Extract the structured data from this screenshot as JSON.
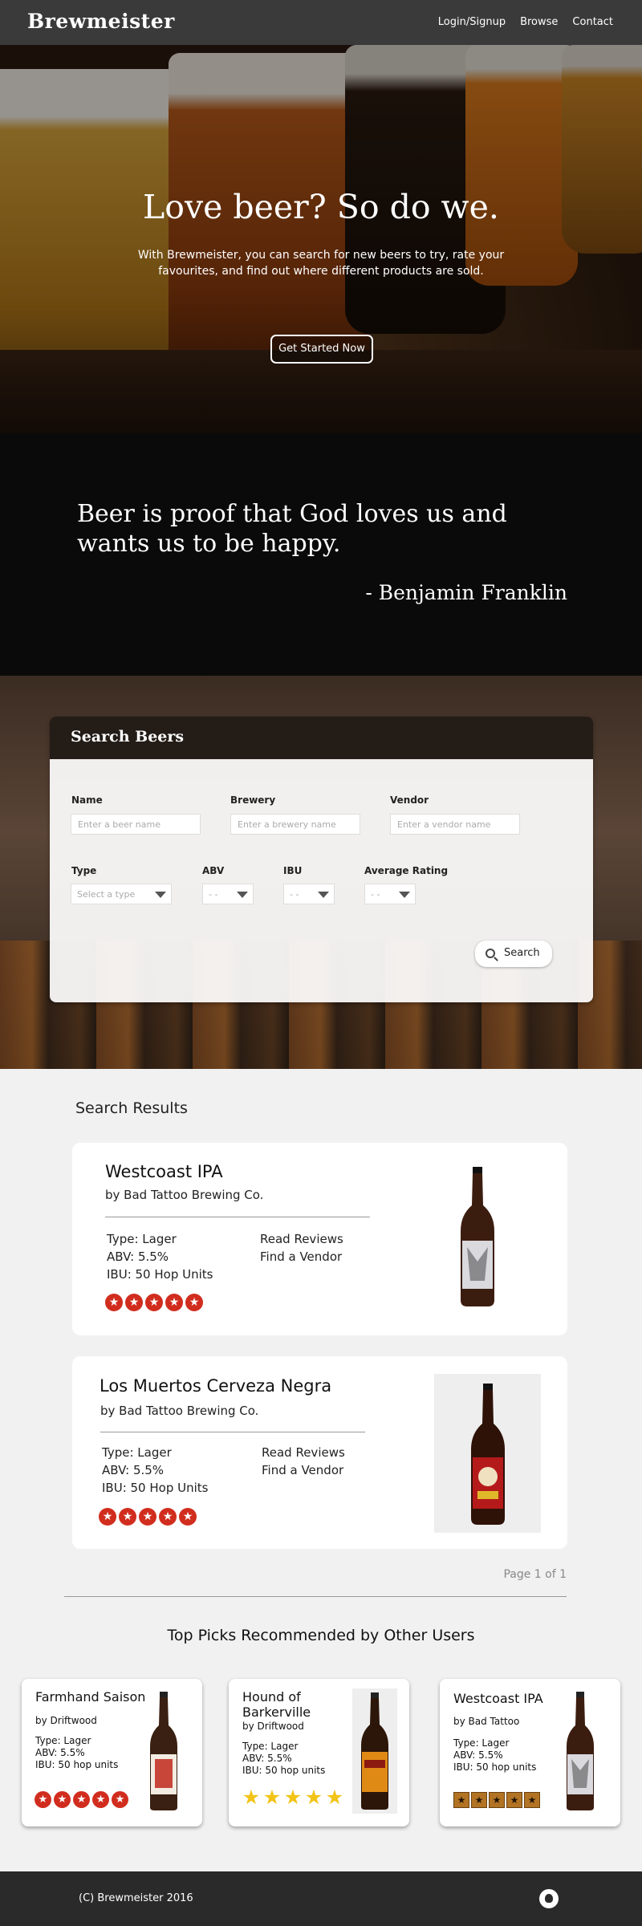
{
  "nav": {
    "brand": "Brewmeister",
    "links": [
      "Login/Signup",
      "Browse",
      "Contact"
    ]
  },
  "hero": {
    "title": "Love beer? So do we.",
    "text": "With Brewmeister, you can search for new beers to try, rate your favourites, and find out where different products are sold.",
    "button": "Get Started Now"
  },
  "quote": {
    "text": "Beer is proof that God loves us and wants us to be happy.",
    "author": "-  Benjamin Franklin"
  },
  "search": {
    "title": "Search Beers",
    "name_label": "Name",
    "name_placeholder": "Enter a beer name",
    "brewery_label": "Brewery",
    "brewery_placeholder": "Enter a brewery name",
    "vendor_label": "Vendor",
    "vendor_placeholder": "Enter a vendor name",
    "type_label": "Type",
    "type_value": "Select a type",
    "abv_label": "ABV",
    "abv_value": "- -",
    "ibu_label": "IBU",
    "ibu_value": "- -",
    "rating_label": "Average Rating",
    "rating_value": "- -",
    "button": "Search"
  },
  "results": {
    "title": "Search Results",
    "items": [
      {
        "name": "Westcoast IPA",
        "by": "by Bad Tattoo Brewing Co.",
        "type": "Type: Lager",
        "abv": "ABV: 5.5%",
        "ibu": "IBU: 50 Hop Units",
        "reviews": "Read Reviews",
        "vendor": "Find a Vendor",
        "rating": 5,
        "bottle_label": "#d9d9de"
      },
      {
        "name": "Los Muertos Cerveza Negra",
        "by": "by Bad Tattoo Brewing Co.",
        "type": "Type: Lager",
        "abv": "ABV: 5.5%",
        "ibu": "IBU: 50 Hop Units",
        "reviews": "Read Reviews",
        "vendor": "Find a Vendor",
        "rating": 5,
        "bottle_label": "#b51a1a"
      }
    ],
    "pagination": "Page 1 of 1"
  },
  "picks": {
    "title": "Top Picks Recommended by Other Users",
    "items": [
      {
        "name": "Farmhand Saison",
        "by": "by Driftwood",
        "type": "Type: Lager",
        "abv": "ABV: 5.5%",
        "ibu": "IBU: 50 hop units",
        "rating": 5,
        "star_style": "red-circle",
        "bottle_label": "#c8453a"
      },
      {
        "name": "Hound of Barkerville",
        "by": "by Driftwood",
        "type": "Type: Lager",
        "abv": "ABV: 5.5%",
        "ibu": "IBU: 50 hop units",
        "rating": 5,
        "star_style": "gold-star",
        "bottle_label": "#e08a16"
      },
      {
        "name": "Westcoast IPA",
        "by": "by Bad Tattoo",
        "type": "Type: Lager",
        "abv": "ABV: 5.5%",
        "ibu": "IBU: 50 hop units",
        "rating": 5,
        "star_style": "bronze-square",
        "bottle_label": "#d9d9de"
      }
    ]
  },
  "footer": {
    "copyright": "(C) Brewmeister 2016",
    "github_icon": "github-icon"
  }
}
